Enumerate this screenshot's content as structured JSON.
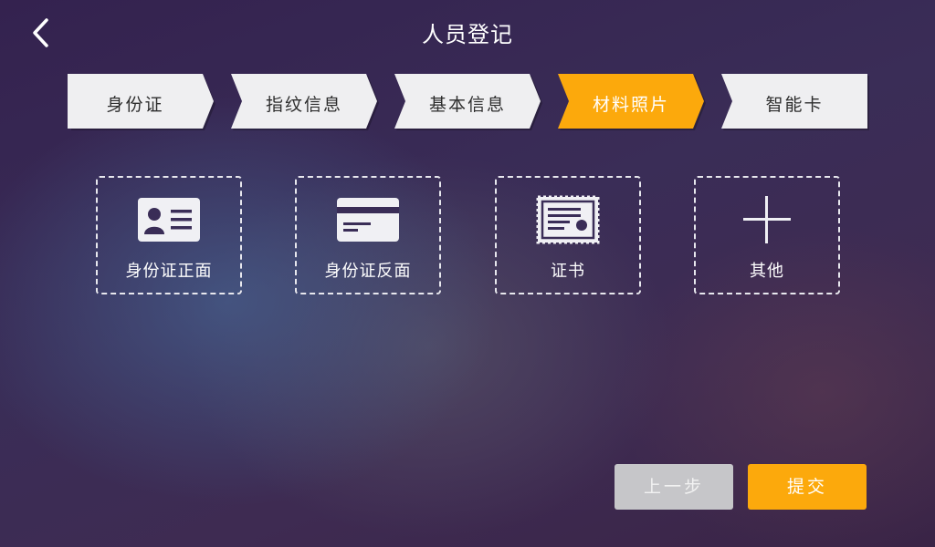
{
  "header": {
    "title": "人员登记",
    "back_icon": "chevron-left-icon"
  },
  "steps": [
    {
      "label": "身份证",
      "active": false
    },
    {
      "label": "指纹信息",
      "active": false
    },
    {
      "label": "基本信息",
      "active": false
    },
    {
      "label": "材料照片",
      "active": true
    },
    {
      "label": "智能卡",
      "active": false
    }
  ],
  "tiles": [
    {
      "label": "身份证正面",
      "icon": "id-card-front-icon"
    },
    {
      "label": "身份证反面",
      "icon": "id-card-back-icon"
    },
    {
      "label": "证书",
      "icon": "certificate-icon"
    },
    {
      "label": "其他",
      "icon": "plus-icon"
    }
  ],
  "footer": {
    "prev_label": "上一步",
    "submit_label": "提交"
  },
  "colors": {
    "accent": "#fca90c",
    "step_inactive": "#efeff1",
    "prev_button": "#c6c6c9",
    "icon_fill": "#f0f0f4"
  }
}
